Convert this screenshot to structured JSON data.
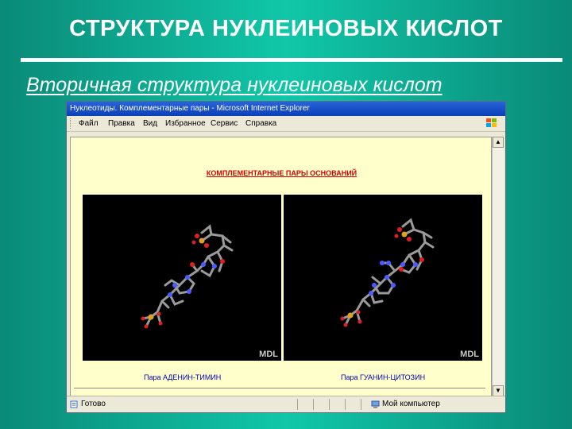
{
  "slide": {
    "title": "СТРУКТУРА НУКЛЕИНОВЫХ КИСЛОТ",
    "subtitle": "Вторичная структура нуклеиновых кислот"
  },
  "browser": {
    "window_title": "Нуклеотиды. Комплементарные пары - Microsoft Internet Explorer",
    "menu": [
      "Файл",
      "Правка",
      "Вид",
      "Избранное",
      "Сервис",
      "Справка"
    ],
    "status": {
      "text": "Готово",
      "zone": "Мой компьютер"
    }
  },
  "page": {
    "heading": "КОМПЛЕМЕНТАРНЫЕ ПАРЫ ОСНОВАНИЙ",
    "panels": [
      {
        "watermark": "MDL",
        "caption": "Пара АДЕНИН-ТИМИН"
      },
      {
        "watermark": "MDL",
        "caption": "Пара ГУАНИН-ЦИТОЗИН"
      }
    ]
  },
  "colors": {
    "slide_background": "#10c7a8",
    "page_background": "#ffffcc",
    "heading": "#d40000",
    "caption": "#0000aa",
    "titlebar": "#0a3fb8",
    "atom_carbon": "#9a9a9a",
    "atom_oxygen": "#e02020",
    "atom_nitrogen": "#4a5cff",
    "atom_phosphorus": "#e0a020"
  },
  "icons": {
    "window_icon": "ie-page-icon",
    "brand": "windows-flag-icon",
    "status_done": "page-done-icon",
    "zone": "my-computer-icon"
  }
}
